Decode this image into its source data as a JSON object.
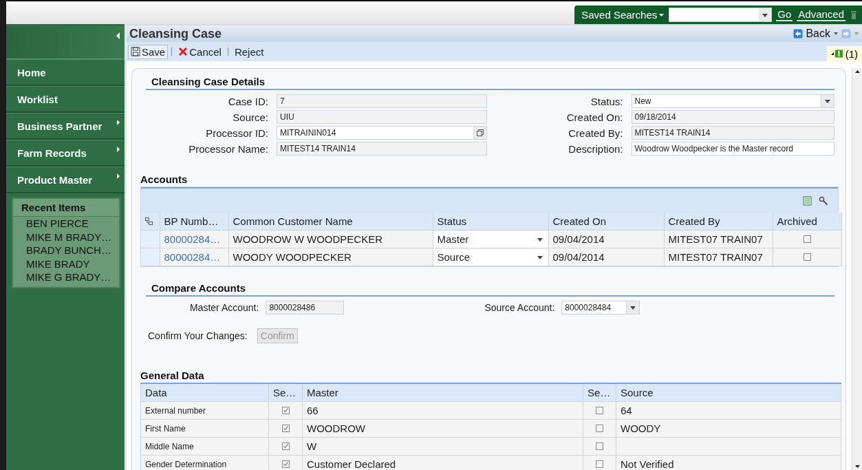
{
  "header": {
    "saved_searches": "Saved Searches",
    "go": "Go",
    "advanced": "Advanced"
  },
  "sidebar": {
    "items": [
      {
        "label": "Home",
        "has_submenu": false
      },
      {
        "label": "Worklist",
        "has_submenu": false
      },
      {
        "label": "Business Partner",
        "has_submenu": true
      },
      {
        "label": "Farm Records",
        "has_submenu": true
      },
      {
        "label": "Product Master",
        "has_submenu": true
      }
    ],
    "recent_title": "Recent Items",
    "recent_items": [
      "BEN PIERCE",
      "MIKE M BRADY…",
      "BRADY BUNCH…",
      "MIKE BRADY",
      "MIKE G BRADY…"
    ]
  },
  "page": {
    "title": "Cleansing Case",
    "back": "Back",
    "toolbar": [
      {
        "label": "Save",
        "kind": "save"
      },
      {
        "label": "Cancel",
        "kind": "cancel"
      },
      {
        "label": "Reject",
        "kind": "plain"
      }
    ],
    "messages": "(1)"
  },
  "details": {
    "title": "Cleansing Case Details",
    "left_fields": [
      {
        "label": "Case ID:",
        "value": "7",
        "kind": "readonly"
      },
      {
        "label": "Source:",
        "value": "UIU",
        "kind": "readonly"
      },
      {
        "label": "Processor ID:",
        "value": "MITRAININ014",
        "kind": "lookup"
      },
      {
        "label": "Processor Name:",
        "value": "MITEST14 TRAIN14",
        "kind": "readonly"
      }
    ],
    "right_fields": [
      {
        "label": "Status:",
        "value": "New",
        "kind": "dropdown"
      },
      {
        "label": "Created On:",
        "value": "09/18/2014",
        "kind": "readonly"
      },
      {
        "label": "Created By:",
        "value": "MITEST14 TRAIN14",
        "kind": "readonly"
      },
      {
        "label": "Description:",
        "value": "Woodrow Woodpecker is the Master record",
        "kind": "input"
      }
    ]
  },
  "accounts": {
    "title": "Accounts",
    "columns": [
      "BP Numb…",
      "Common Customer Name",
      "Status",
      "Created On",
      "Created By",
      "Archived"
    ],
    "rows": [
      {
        "bp_number": "80000284…",
        "name": "WOODROW W WOODPECKER",
        "status": "Master",
        "created_on": "09/04/2014",
        "created_by": "MITEST07 TRAIN07",
        "archived": false
      },
      {
        "bp_number": "80000284…",
        "name": "WOODY WOODPECKER",
        "status": "Source",
        "created_on": "09/04/2014",
        "created_by": "MITEST07 TRAIN07",
        "archived": false
      }
    ]
  },
  "compare": {
    "title": "Compare Accounts",
    "master": {
      "label": "Master Account:",
      "value": "8000028486",
      "kind": "readonly"
    },
    "source": {
      "label": "Source Account:",
      "value": "8000028484",
      "kind": "dropdown"
    },
    "confirm_label": "Confirm Your Changes:",
    "confirm_button": "Confirm",
    "confirm_disabled": true
  },
  "general": {
    "title": "General Data",
    "columns": [
      "Data",
      "Se…",
      "Master",
      "Se…",
      "Source"
    ],
    "rows": [
      {
        "data": "External number",
        "master_checked": true,
        "master": "66",
        "source_checked": false,
        "source": "64"
      },
      {
        "data": "First Name",
        "master_checked": true,
        "master": "WOODROW",
        "source_checked": false,
        "source": "WOODY"
      },
      {
        "data": "Middle Name",
        "master_checked": true,
        "master": "W",
        "source_checked": false
      },
      {
        "data": "Gender Determination",
        "master_checked": true,
        "master": "Customer Declared",
        "source_checked": false,
        "source": "Not Verified"
      }
    ]
  }
}
